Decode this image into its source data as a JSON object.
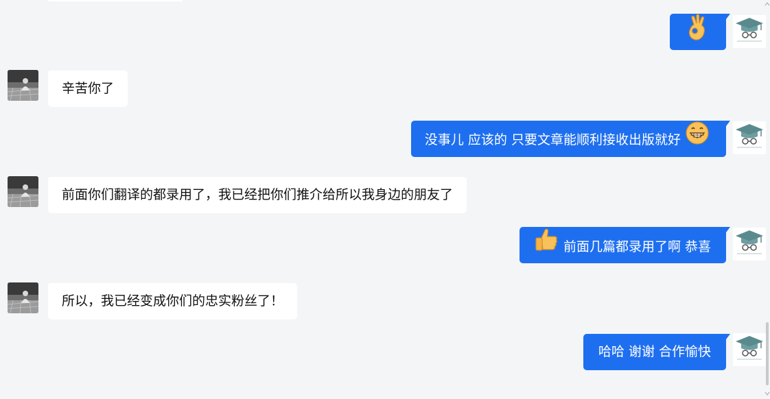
{
  "chat": {
    "messages": [
      {
        "side": "out",
        "kind": "emoji",
        "emoji": "ok-hand"
      },
      {
        "side": "in",
        "text": "辛苦你了"
      },
      {
        "side": "out",
        "text": "没事儿 应该的 只要文章能顺利接收出版就好",
        "emoji": "grin"
      },
      {
        "side": "in",
        "text": "前面你们翻译的都录用了，我已经把你们推介给所以我身边的朋友了"
      },
      {
        "side": "out",
        "text": "前面几篇都录用了啊 恭喜",
        "emoji": "thumbs-up"
      },
      {
        "side": "in",
        "text": "所以，我已经变成你们的忠实粉丝了！"
      },
      {
        "side": "out",
        "text": "哈哈 谢谢 合作愉快"
      }
    ]
  },
  "colors": {
    "background": "#f4f5f7",
    "outgoing_bubble": "#1e6ff0",
    "incoming_bubble": "#ffffff"
  },
  "icons": {
    "contact_avatar": "grayscale-person-photo",
    "self_avatar": "graduation-cap-glasses-logo",
    "scroll_up": "chevron-up-icon",
    "scroll_down": "chevron-down-icon"
  }
}
